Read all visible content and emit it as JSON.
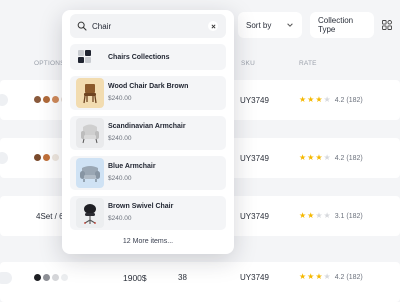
{
  "toolbar": {
    "sort_label": "Sort by",
    "collection_label": "Collection Type"
  },
  "columns": [
    "OPTIONS",
    "SKU",
    "RATE"
  ],
  "rows": [
    {
      "option_text": "",
      "sku": "UY3749",
      "stars": 4,
      "rating": "4.2 (182)",
      "colors": [
        "#8a5a3c",
        "#b06a3a",
        "#d08a5a",
        "#eadfd6"
      ]
    },
    {
      "option_text": "",
      "sku": "UY3749",
      "stars": 4,
      "rating": "4.2 (182)",
      "colors": [
        "#7a4a2c",
        "#c0703a",
        "#efe7df"
      ]
    },
    {
      "option_text": "4Set / 6",
      "sku": "UY3749",
      "stars": 3,
      "rating": "3.1 (182)",
      "colors": []
    },
    {
      "option_text": "",
      "price": "1900$",
      "qty": "38",
      "sku": "UY3749",
      "stars": 4,
      "rating": "4.2 (182)",
      "colors": [
        "#1e1f24",
        "#8e9096",
        "#d5d6d9",
        "#eceef0"
      ]
    }
  ],
  "search": {
    "value": "Chair",
    "collection_label": "Chairs Collections",
    "products": [
      {
        "name": "Wood Chair Dark Brown",
        "price": "$240.00",
        "thumb_bg": "#f2dcb0",
        "icon": "wood-chair-icon"
      },
      {
        "name": "Scandinavian Armchair",
        "price": "$240.00",
        "thumb_bg": "#e9eaec",
        "icon": "armchair-icon"
      },
      {
        "name": "Blue Armchair",
        "price": "$240.00",
        "thumb_bg": "#cfe2f4",
        "icon": "blue-armchair-icon"
      },
      {
        "name": "Brown Swivel Chair",
        "price": "$240.00",
        "thumb_bg": "#eceef0",
        "icon": "swivel-chair-icon"
      }
    ],
    "more_label": "12 More items..."
  },
  "colors": {
    "star": "#f5b800",
    "star_off": "#d6d8dc",
    "surface": "#f4f5f7"
  }
}
